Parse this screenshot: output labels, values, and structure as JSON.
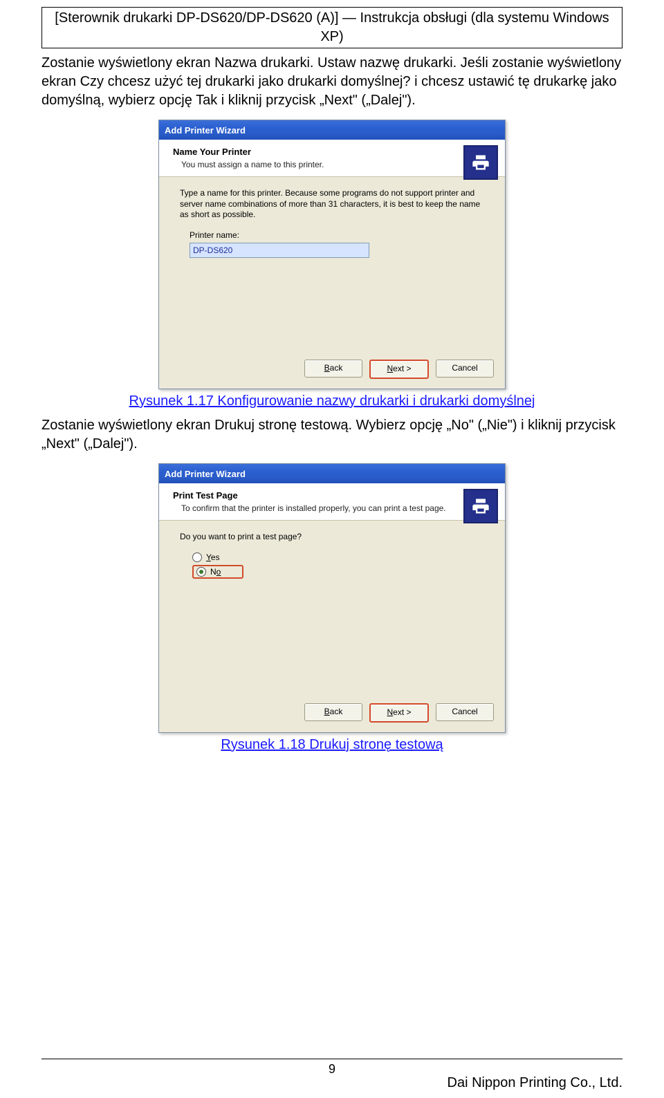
{
  "header": {
    "line1": "[Sterownik drukarki DP-DS620/DP-DS620 (A)] — Instrukcja obsługi (dla systemu Windows",
    "line2": "XP)"
  },
  "para1": "Zostanie wyświetlony ekran Nazwa drukarki. Ustaw nazwę drukarki. Jeśli zostanie wyświetlony ekran Czy chcesz użyć tej drukarki jako drukarki domyślnej? i chcesz ustawić tę drukarkę jako domyślną, wybierz opcję Tak i kliknij przycisk „Next\" („Dalej\").",
  "para2": "Zostanie wyświetlony ekran Drukuj stronę testową. Wybierz opcję „No\" („Nie\") i kliknij przycisk „Next\" („Dalej\").",
  "caption1": "Rysunek 1.17 Konfigurowanie nazwy drukarki i drukarki domyślnej",
  "caption2": "Rysunek 1.18 Drukuj stronę testową",
  "dlg1": {
    "title": "Add Printer Wizard",
    "heading": "Name Your Printer",
    "sub": "You must assign a name to this printer.",
    "desc": "Type a name for this printer. Because some programs do not support printer and server name combinations of more than 31 characters, it is best to keep the name as short as possible.",
    "field_label": "Printer name:",
    "field_value": "DP-DS620",
    "back": "< Back",
    "next": "Next >",
    "cancel": "Cancel"
  },
  "dlg2": {
    "title": "Add Printer Wizard",
    "heading": "Print Test Page",
    "sub": "To confirm that the printer is installed properly, you can print a test page.",
    "question": "Do you want to print a test page?",
    "yes": "Yes",
    "no": "No",
    "back": "< Back",
    "next": "Next >",
    "cancel": "Cancel"
  },
  "footer": {
    "page": "9",
    "company": "Dai Nippon Printing Co., Ltd."
  }
}
